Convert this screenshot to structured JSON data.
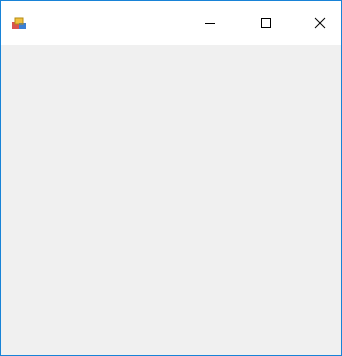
{
  "window": {
    "title": "",
    "controls": {
      "minimize_icon": "minimize-icon",
      "maximize_icon": "maximize-icon",
      "close_icon": "close-icon"
    },
    "colors": {
      "border": "#1883d7",
      "titlebar": "#ffffff",
      "client": "#f0f0f0"
    }
  }
}
